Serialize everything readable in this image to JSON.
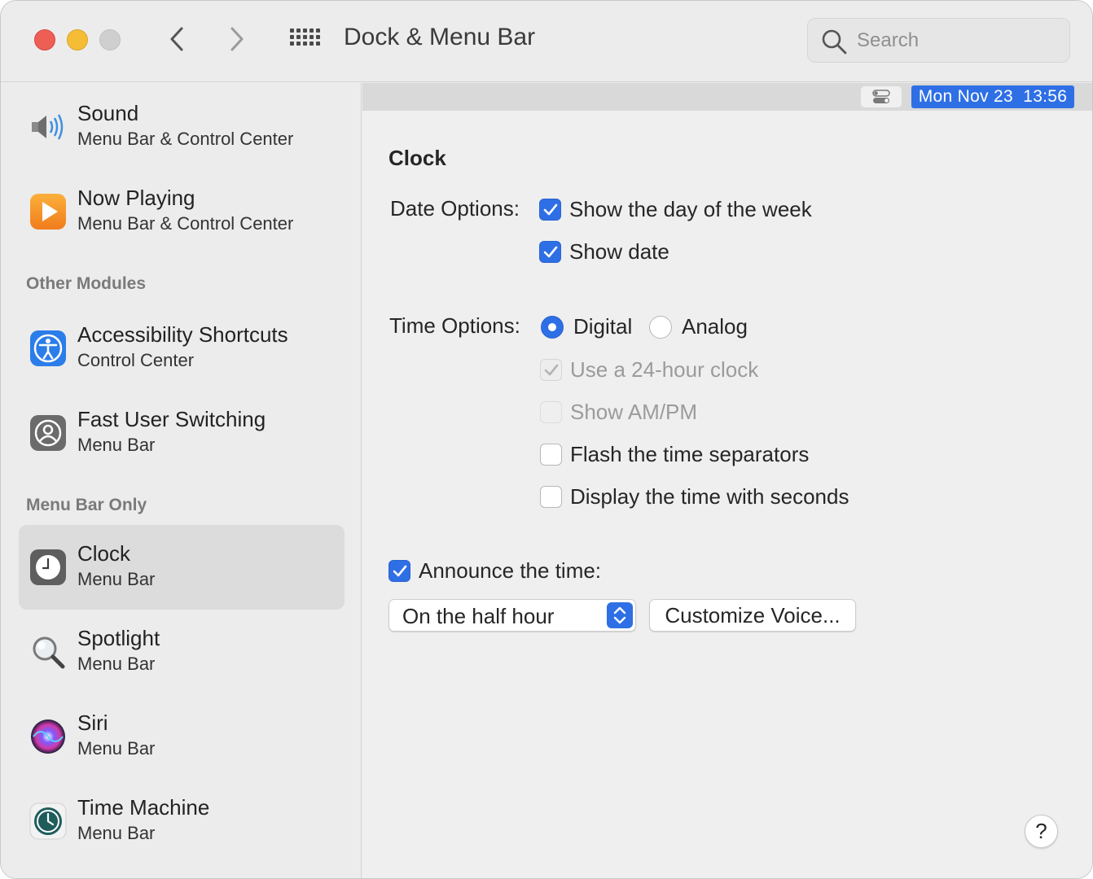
{
  "window": {
    "title": "Dock & Menu Bar",
    "search_placeholder": "Search"
  },
  "menubar_preview": {
    "clock_text": "Mon Nov 23  13:56"
  },
  "sidebar": {
    "items": [
      {
        "title": "Sound",
        "subtitle": "Menu Bar & Control Center",
        "icon": "speaker-icon"
      },
      {
        "title": "Now Playing",
        "subtitle": "Menu Bar & Control Center",
        "icon": "play-icon"
      },
      {
        "title": "Accessibility Shortcuts",
        "subtitle": "Control Center",
        "icon": "accessibility-icon"
      },
      {
        "title": "Fast User Switching",
        "subtitle": "Menu Bar",
        "icon": "user-icon"
      },
      {
        "title": "Clock",
        "subtitle": "Menu Bar",
        "icon": "clock-icon",
        "selected": true
      },
      {
        "title": "Spotlight",
        "subtitle": "Menu Bar",
        "icon": "magnifier-icon"
      },
      {
        "title": "Siri",
        "subtitle": "Menu Bar",
        "icon": "siri-icon"
      },
      {
        "title": "Time Machine",
        "subtitle": "Menu Bar",
        "icon": "time-machine-icon"
      }
    ],
    "sections": {
      "other_modules": "Other Modules",
      "menu_bar_only": "Menu Bar Only"
    }
  },
  "clock_panel": {
    "title": "Clock",
    "date_options_label": "Date Options:",
    "show_day_of_week": {
      "label": "Show the day of the week",
      "checked": true
    },
    "show_date": {
      "label": "Show date",
      "checked": true
    },
    "time_options_label": "Time Options:",
    "digital": {
      "label": "Digital",
      "selected": true
    },
    "analog": {
      "label": "Analog",
      "selected": false
    },
    "use_24_hour": {
      "label": "Use a 24-hour clock",
      "checked": true,
      "enabled": false
    },
    "show_ampm": {
      "label": "Show AM/PM",
      "checked": false,
      "enabled": false
    },
    "flash_separators": {
      "label": "Flash the time separators",
      "checked": false
    },
    "display_seconds": {
      "label": "Display the time with seconds",
      "checked": false
    },
    "announce_time": {
      "label": "Announce the time:",
      "checked": true
    },
    "announce_interval": "On the half hour",
    "customize_voice": "Customize Voice...",
    "help": "?"
  },
  "colors": {
    "accent": "#2e6fe5",
    "close": "#ed5e55",
    "minimize": "#f5bd35",
    "zoom_disabled": "#d0cfcf"
  }
}
